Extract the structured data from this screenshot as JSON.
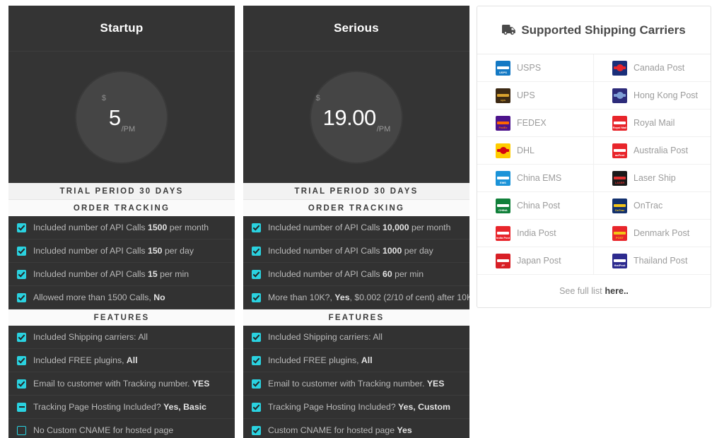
{
  "plans": [
    {
      "name": "Startup",
      "currency": "$",
      "amount": "5",
      "period": "/PM",
      "trial_band": "TRIAL PERIOD 30 DAYS",
      "section_band": "ORDER TRACKING",
      "features_band": "FEATURES",
      "tracking_rows": [
        {
          "state": "checked",
          "text": "Included number of API Calls ",
          "strong": "1500",
          "tail": " per month"
        },
        {
          "state": "checked",
          "text": "Included number of API Calls ",
          "strong": "150",
          "tail": " per day"
        },
        {
          "state": "checked",
          "text": "Included number of API Calls ",
          "strong": "15",
          "tail": " per min"
        },
        {
          "state": "checked",
          "text": "Allowed more than 1500 Calls, ",
          "strong": "No",
          "tail": ""
        }
      ],
      "feature_rows": [
        {
          "state": "checked",
          "text": "Included Shipping carriers: All",
          "strong": "",
          "tail": ""
        },
        {
          "state": "checked",
          "text": "Included FREE plugins, ",
          "strong": "All",
          "tail": ""
        },
        {
          "state": "checked",
          "text": "Email to customer with Tracking number. ",
          "strong": "YES",
          "tail": ""
        },
        {
          "state": "partial",
          "text": "Tracking Page Hosting Included? ",
          "strong": "Yes, Basic",
          "tail": ""
        },
        {
          "state": "empty",
          "text": "No Custom CNAME for hosted page",
          "strong": "",
          "tail": ""
        }
      ]
    },
    {
      "name": "Serious",
      "currency": "$",
      "amount": "19.00",
      "period": "/PM",
      "trial_band": "TRIAL PERIOD 30 DAYS",
      "section_band": "ORDER TRACKING",
      "features_band": "FEATURES",
      "tracking_rows": [
        {
          "state": "checked",
          "text": "Included number of API Calls ",
          "strong": "10,000",
          "tail": " per month"
        },
        {
          "state": "checked",
          "text": "Included number of API Calls ",
          "strong": "1000",
          "tail": " per day"
        },
        {
          "state": "checked",
          "text": "Included number of API Calls ",
          "strong": "60",
          "tail": " per min"
        },
        {
          "state": "checked",
          "text": "More than 10K?, ",
          "strong": "Yes",
          "tail": ", $0.002 (2/10 of cent) after 10K"
        }
      ],
      "feature_rows": [
        {
          "state": "checked",
          "text": "Included Shipping carriers: All",
          "strong": "",
          "tail": ""
        },
        {
          "state": "checked",
          "text": "Included FREE plugins, ",
          "strong": "All",
          "tail": ""
        },
        {
          "state": "checked",
          "text": "Email to customer with Tracking number. ",
          "strong": "YES",
          "tail": ""
        },
        {
          "state": "checked",
          "text": "Tracking Page Hosting Included? ",
          "strong": "Yes, Custom",
          "tail": ""
        },
        {
          "state": "checked",
          "text": "Custom CNAME for hosted page ",
          "strong": "Yes",
          "tail": ""
        }
      ]
    }
  ],
  "carriers_panel": {
    "icon": "truck-icon",
    "title": "Supported Shipping Carriers",
    "footer_text": "See full list ",
    "footer_link": "here..",
    "items": [
      {
        "name": "USPS",
        "bg": "#1479c4",
        "fg": "#ffffff",
        "tag": "USPS"
      },
      {
        "name": "Canada Post",
        "bg": "#1a2f7a",
        "fg": "#e8252b",
        "tag": ""
      },
      {
        "name": "UPS",
        "bg": "#3d2a14",
        "fg": "#d9a22e",
        "tag": "ups"
      },
      {
        "name": "Hong Kong Post",
        "bg": "#2d2b7a",
        "fg": "#7f9fd6",
        "tag": ""
      },
      {
        "name": "FEDEX",
        "bg": "#4d148c",
        "fg": "#ff6600",
        "tag": "FedEx"
      },
      {
        "name": "Royal Mail",
        "bg": "#e8252b",
        "fg": "#ffffff",
        "tag": "Royal Mail"
      },
      {
        "name": "DHL",
        "bg": "#fecc00",
        "fg": "#d40511",
        "tag": ""
      },
      {
        "name": "Australia Post",
        "bg": "#e8252b",
        "fg": "#ffffff",
        "tag": "auPost"
      },
      {
        "name": "China EMS",
        "bg": "#1b93d8",
        "fg": "#ffffff",
        "tag": "EMS"
      },
      {
        "name": "Laser Ship",
        "bg": "#1a1a1a",
        "fg": "#e03030",
        "tag": "LASER"
      },
      {
        "name": "China Post",
        "bg": "#11803a",
        "fg": "#ffffff",
        "tag": "CHINA"
      },
      {
        "name": "OnTrac",
        "bg": "#12306e",
        "fg": "#f2c417",
        "tag": "OnTrac"
      },
      {
        "name": "India Post",
        "bg": "#e8252b",
        "fg": "#ffffff",
        "tag": "India Post"
      },
      {
        "name": "Denmark Post",
        "bg": "#e8252b",
        "fg": "#f2c417",
        "tag": "POST"
      },
      {
        "name": "Japan Post",
        "bg": "#d81f26",
        "fg": "#ffffff",
        "tag": "JP"
      },
      {
        "name": "Thailand Post",
        "bg": "#2d2b8f",
        "fg": "#ffffff",
        "tag": "thaiPost"
      }
    ]
  }
}
